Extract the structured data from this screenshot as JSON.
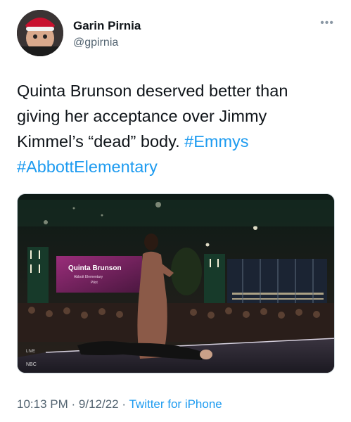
{
  "author": {
    "name": "Garin Pirnia",
    "handle": "@gpirnia"
  },
  "more_icon": "ellipsis-icon",
  "tweet": {
    "text_plain": "Quinta Brunson deserved better than giving her acceptance over Jimmy Kimmel’s “dead” body.",
    "hashtags": [
      "#Emmys",
      "#AbbottElementary"
    ]
  },
  "media": {
    "screen_name": "Quinta Brunson",
    "screen_show": "Abbott Elementary",
    "screen_role": "Pilot",
    "network": "NBC",
    "live": "LIVE"
  },
  "meta": {
    "time": "10:13 PM",
    "date": "9/12/22",
    "source": "Twitter for iPhone",
    "separator": "·"
  },
  "colors": {
    "link": "#1d9bf0",
    "secondary": "#536471",
    "text": "#0f1419"
  }
}
